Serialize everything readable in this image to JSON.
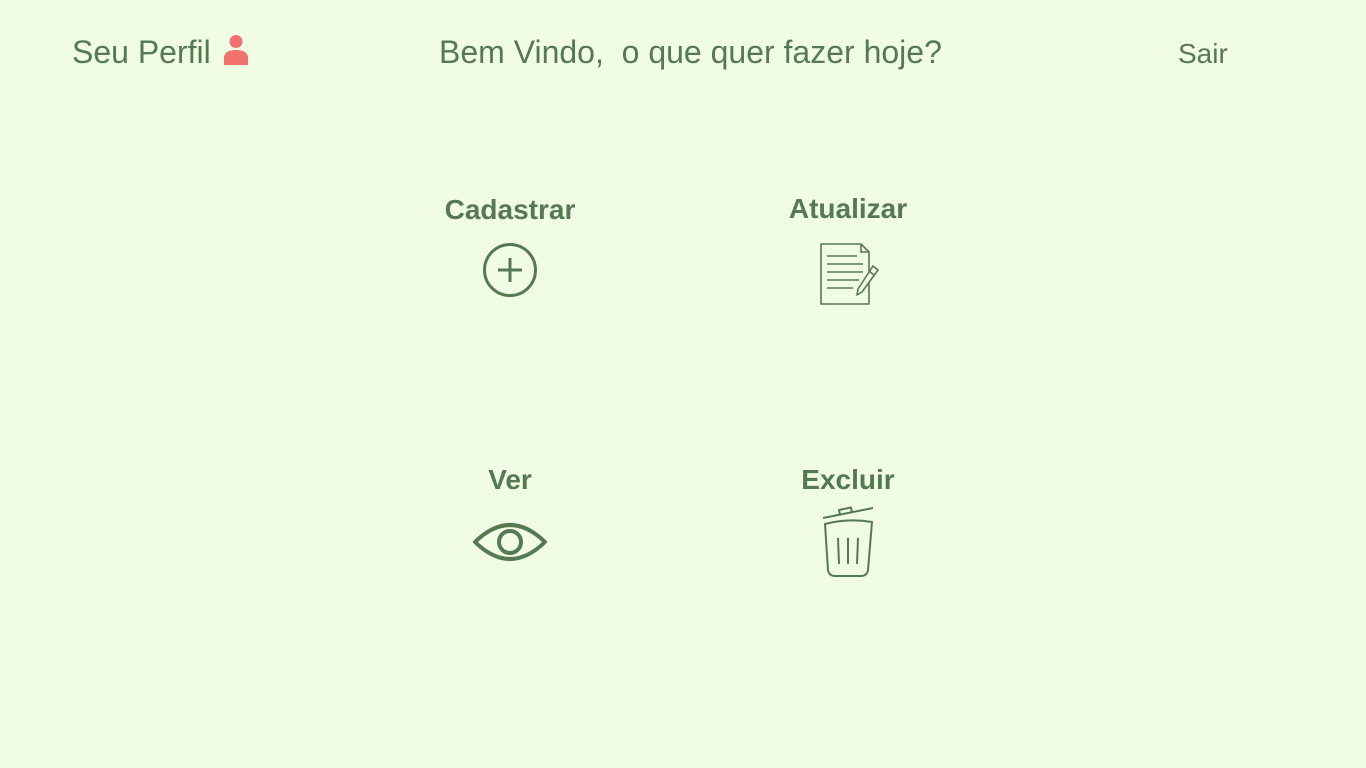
{
  "header": {
    "profile_label": "Seu Perfil",
    "profile_icon": "user-icon",
    "welcome_text": "Bem Vindo,  o que quer fazer hoje?",
    "logout_label": "Sair",
    "accent_color": "#f2716f",
    "text_color": "#557a52",
    "background_color": "#f0fde4"
  },
  "actions": [
    {
      "label": "Cadastrar",
      "icon": "plus-circle-icon"
    },
    {
      "label": "Atualizar",
      "icon": "document-edit-icon"
    },
    {
      "label": "Ver",
      "icon": "eye-icon"
    },
    {
      "label": "Excluir",
      "icon": "trash-icon"
    }
  ]
}
